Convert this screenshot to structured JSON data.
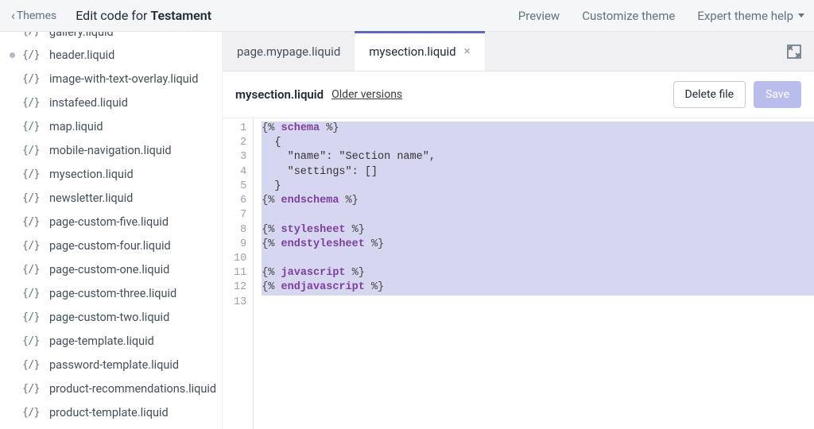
{
  "topbar": {
    "back_label": "Themes",
    "title_prefix": "Edit code for ",
    "title_theme": "Testament",
    "preview_label": "Preview",
    "customize_label": "Customize theme",
    "expert_label": "Expert theme help"
  },
  "sidebar": {
    "files": [
      {
        "name": "gallery.liquid",
        "modified": false,
        "cut": true
      },
      {
        "name": "header.liquid",
        "modified": true
      },
      {
        "name": "image-with-text-overlay.liquid",
        "modified": false
      },
      {
        "name": "instafeed.liquid",
        "modified": false
      },
      {
        "name": "map.liquid",
        "modified": false
      },
      {
        "name": "mobile-navigation.liquid",
        "modified": false
      },
      {
        "name": "mysection.liquid",
        "modified": false
      },
      {
        "name": "newsletter.liquid",
        "modified": false
      },
      {
        "name": "page-custom-five.liquid",
        "modified": false
      },
      {
        "name": "page-custom-four.liquid",
        "modified": false
      },
      {
        "name": "page-custom-one.liquid",
        "modified": false
      },
      {
        "name": "page-custom-three.liquid",
        "modified": false
      },
      {
        "name": "page-custom-two.liquid",
        "modified": false
      },
      {
        "name": "page-template.liquid",
        "modified": false
      },
      {
        "name": "password-template.liquid",
        "modified": false
      },
      {
        "name": "product-recommendations.liquid",
        "modified": false
      },
      {
        "name": "product-template.liquid",
        "modified": false
      }
    ]
  },
  "tabs": [
    {
      "label": "page.mypage.liquid",
      "active": false
    },
    {
      "label": "mysection.liquid",
      "active": true
    }
  ],
  "file_header": {
    "filename": "mysection.liquid",
    "older_versions_label": "Older versions",
    "delete_label": "Delete file",
    "save_label": "Save"
  },
  "code": {
    "line_count": 13,
    "lines": [
      {
        "hl": true,
        "tokens": [
          {
            "t": "delim",
            "v": "{% "
          },
          {
            "t": "key",
            "v": "schema"
          },
          {
            "t": "delim",
            "v": " %}"
          }
        ]
      },
      {
        "hl": true,
        "tokens": [
          {
            "t": "lit",
            "v": "  {"
          }
        ]
      },
      {
        "hl": true,
        "tokens": [
          {
            "t": "lit",
            "v": "    \"name\": \"Section name\","
          }
        ]
      },
      {
        "hl": true,
        "tokens": [
          {
            "t": "lit",
            "v": "    \"settings\": []"
          }
        ]
      },
      {
        "hl": true,
        "tokens": [
          {
            "t": "lit",
            "v": "  }"
          }
        ]
      },
      {
        "hl": true,
        "tokens": [
          {
            "t": "delim",
            "v": "{% "
          },
          {
            "t": "key",
            "v": "endschema"
          },
          {
            "t": "delim",
            "v": " %}"
          }
        ]
      },
      {
        "hl": true,
        "tokens": [
          {
            "t": "lit",
            "v": ""
          }
        ]
      },
      {
        "hl": true,
        "tokens": [
          {
            "t": "delim",
            "v": "{% "
          },
          {
            "t": "key",
            "v": "stylesheet"
          },
          {
            "t": "delim",
            "v": " %}"
          }
        ]
      },
      {
        "hl": true,
        "tokens": [
          {
            "t": "delim",
            "v": "{% "
          },
          {
            "t": "key",
            "v": "endstylesheet"
          },
          {
            "t": "delim",
            "v": " %}"
          }
        ]
      },
      {
        "hl": true,
        "tokens": [
          {
            "t": "lit",
            "v": ""
          }
        ]
      },
      {
        "hl": true,
        "tokens": [
          {
            "t": "delim",
            "v": "{% "
          },
          {
            "t": "key",
            "v": "javascript"
          },
          {
            "t": "delim",
            "v": " %}"
          }
        ]
      },
      {
        "hl": true,
        "tokens": [
          {
            "t": "delim",
            "v": "{% "
          },
          {
            "t": "key",
            "v": "endjavascript"
          },
          {
            "t": "delim",
            "v": " %}"
          }
        ]
      },
      {
        "hl": false,
        "tokens": [
          {
            "t": "lit",
            "v": ""
          }
        ]
      }
    ]
  }
}
